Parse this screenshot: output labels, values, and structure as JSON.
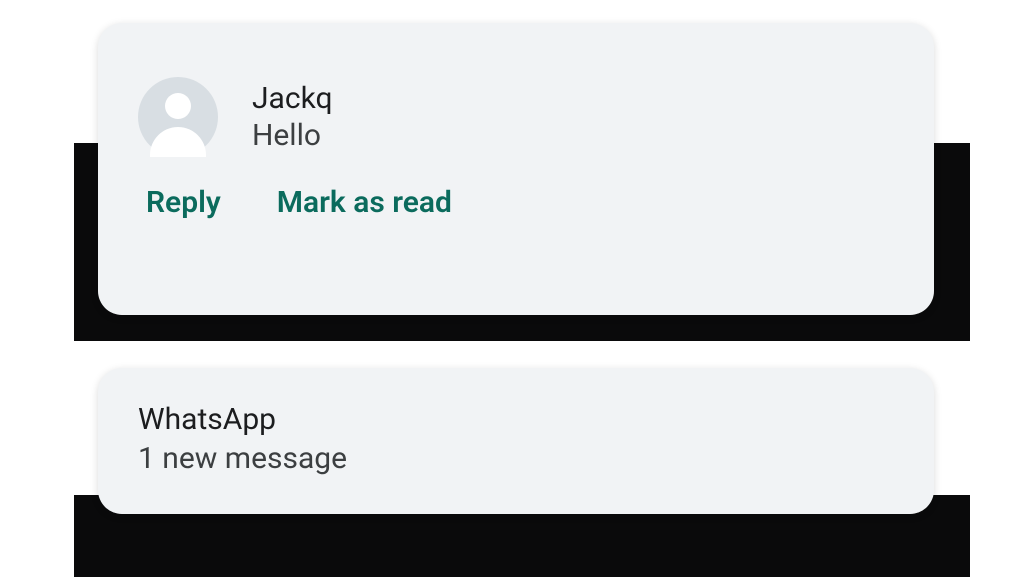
{
  "notification1": {
    "sender": "Jackq",
    "body": "Hello",
    "actions": {
      "reply": "Reply",
      "mark_read": "Mark as read"
    }
  },
  "notification2": {
    "title": "WhatsApp",
    "subtitle": "1 new message"
  }
}
